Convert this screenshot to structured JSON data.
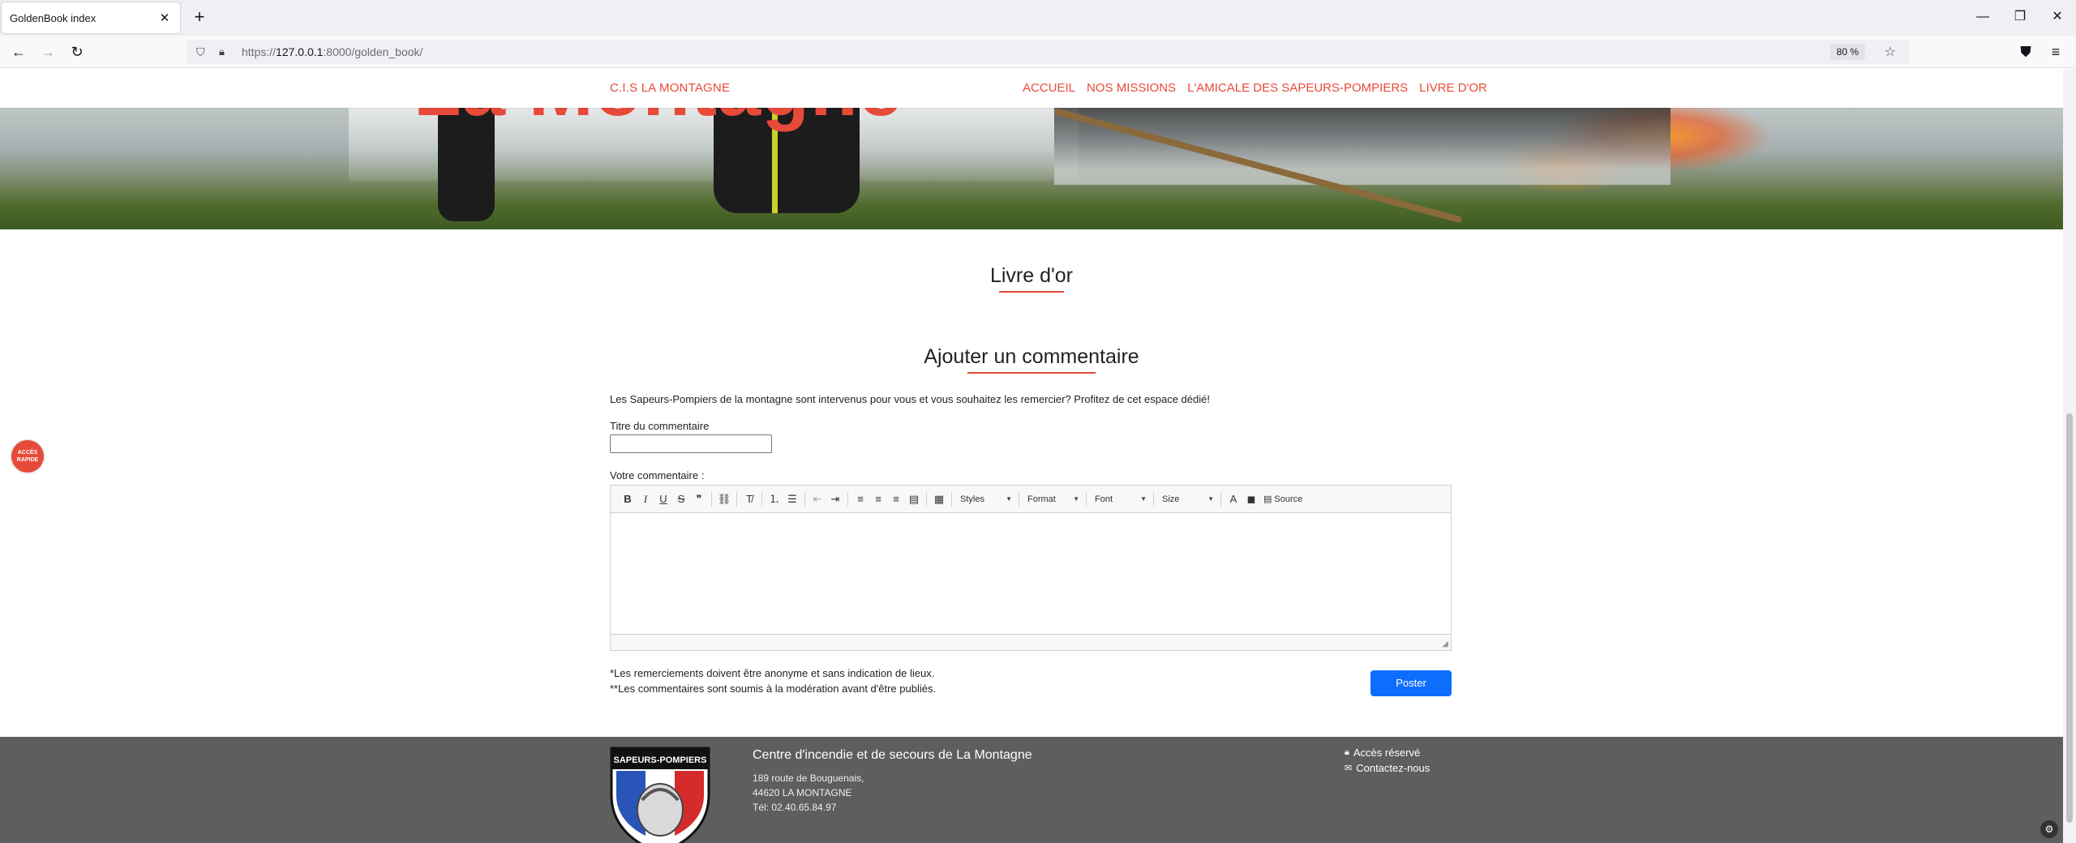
{
  "browser": {
    "tab_title": "GoldenBook index",
    "url_prefix": "https://",
    "url_host": "127.0.0.1",
    "url_rest": ":8000/golden_book/",
    "zoom": "80 %"
  },
  "site": {
    "brand": "C.I.S LA MONTAGNE",
    "menu": [
      "ACCUEIL",
      "NOS MISSIONS",
      "L'AMICALE DES SAPEURS-POMPIERS",
      "LIVRE D'OR"
    ],
    "hero_title": "La Montagne",
    "accent_color": "#e84a39"
  },
  "main": {
    "page_title": "Livre d'or",
    "section_title": "Ajouter un commentaire",
    "intro": "Les Sapeurs-Pompiers de la montagne sont intervenus pour vous et vous souhaitez les remercier? Profitez de cet espace dédié!",
    "title_label": "Titre du commentaire",
    "title_value": "",
    "comment_label": "Votre commentaire :",
    "editor": {
      "styles": "Styles",
      "format": "Format",
      "font": "Font",
      "size": "Size",
      "source": "Source"
    },
    "note1": "*Les remerciements doivent être anonyme et sans indication de lieux.",
    "note2": "**Les commentaires sont soumis à la modération avant d'être publiés.",
    "submit": "Poster",
    "submit_color": "#0d6efd"
  },
  "footer": {
    "badge_text": "SAPEURS-POMPIERS",
    "center_name": "Centre d'incendie et de secours de La Montagne",
    "address_line1": "189 route de Bouguenais,",
    "address_line2": "44620 LA MONTAGNE",
    "phone": "Tél: 02.40.65.84.97",
    "link_reserved": "Accès réservé",
    "link_contact": "Contactez-nous"
  },
  "quick_access": "ACCÈS RAPIDE"
}
